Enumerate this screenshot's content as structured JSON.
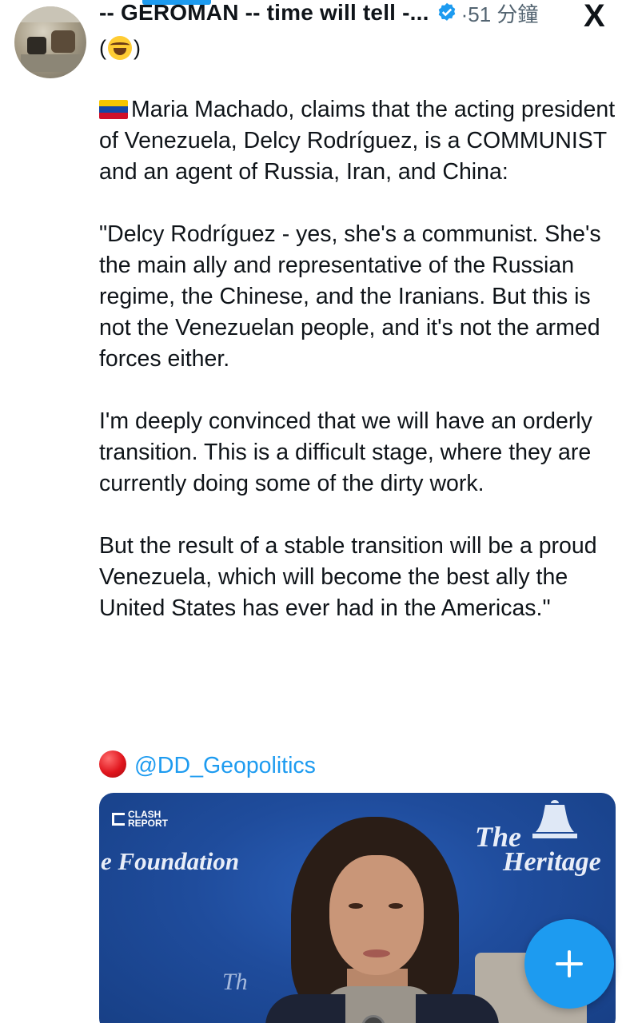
{
  "header": {
    "display_name": "-- GEROMAN -- time will tell -...",
    "timestamp": "·51 分鐘",
    "close_label": "X",
    "emoji_open": "(",
    "emoji_close": ")"
  },
  "tweet": {
    "paragraphs": [
      "Maria Machado, claims that the acting president of Venezuela, Delcy Rodríguez, is a COMMUNIST and an agent of Russia, Iran, and China:",
      "\"Delcy Rodríguez - yes, she's a communist. She's the main ally and representative of the Russian regime, the Chinese, and the Iranians. But this is not the Venezuelan people, and it's not the armed forces either.",
      "I'm deeply convinced that we will have an orderly transition. This is a difficult stage, where they are currently doing some of the dirty work.",
      "But the result of a stable transition will be a proud Venezuela, which will become the best ally the United States has ever had in the Americas.\""
    ],
    "mention": "@DD_Geopolitics"
  },
  "media": {
    "logo_line1": "CLASH",
    "logo_line2": "REPORT",
    "foundation": "e Foundation",
    "heritage_the": "The",
    "heritage_word": "Heritage",
    "lower_text": "Th"
  },
  "colors": {
    "accent": "#1d9bf0",
    "text": "#0f1419",
    "muted": "#536471"
  },
  "icons": {
    "verified": "verified-badge-icon",
    "close": "x-logo-icon",
    "compose": "plus-icon"
  }
}
